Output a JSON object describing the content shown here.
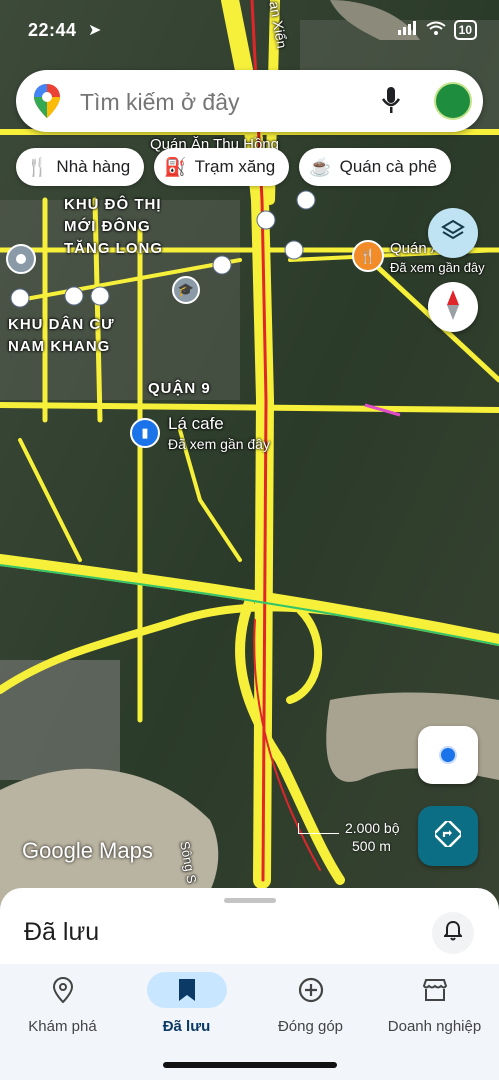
{
  "status": {
    "time": "22:44",
    "battery": "10"
  },
  "search": {
    "placeholder": "Tìm kiếm ở đây"
  },
  "chips": [
    {
      "label": "Nhà hàng",
      "icon": "restaurant-icon"
    },
    {
      "label": "Trạm xăng",
      "icon": "gas-station-icon"
    },
    {
      "label": "Quán cà phê",
      "icon": "coffee-icon"
    }
  ],
  "map": {
    "areas": [
      {
        "text": "KHU ĐÔ THỊ\nMỚI ĐÔNG\nTĂNG LONG"
      },
      {
        "text": "KHU DÂN CƯ\nNAM KHANG"
      },
      {
        "text": "QUẬN 9"
      }
    ],
    "top_label": "Quán Ăn Thu Hồng",
    "road_label": "an Xiển",
    "poi_cafe": {
      "name": "Lá cafe",
      "note": "Đã xem gần đây"
    },
    "poi_restaurant": {
      "name": "Quán Ăn 15",
      "note": "Đã xem gần đây"
    },
    "river_label": "Sông S",
    "scale_ft": "2.000 bộ",
    "scale_m": "500 m",
    "watermark": "Google Maps"
  },
  "sheet": {
    "title": "Đã lưu"
  },
  "nav": [
    {
      "label": "Khám phá",
      "icon": "explore-pin-icon"
    },
    {
      "label": "Đã lưu",
      "icon": "bookmark-icon"
    },
    {
      "label": "Đóng góp",
      "icon": "add-circle-icon"
    },
    {
      "label": "Doanh nghiệp",
      "icon": "storefront-icon"
    }
  ],
  "colors": {
    "highway": "#f7f03a",
    "highway_core": "#e0262b",
    "accent_blue": "#1a73e8",
    "nav_active": "#c8e6ff",
    "directions_fab": "#0b6e84"
  }
}
